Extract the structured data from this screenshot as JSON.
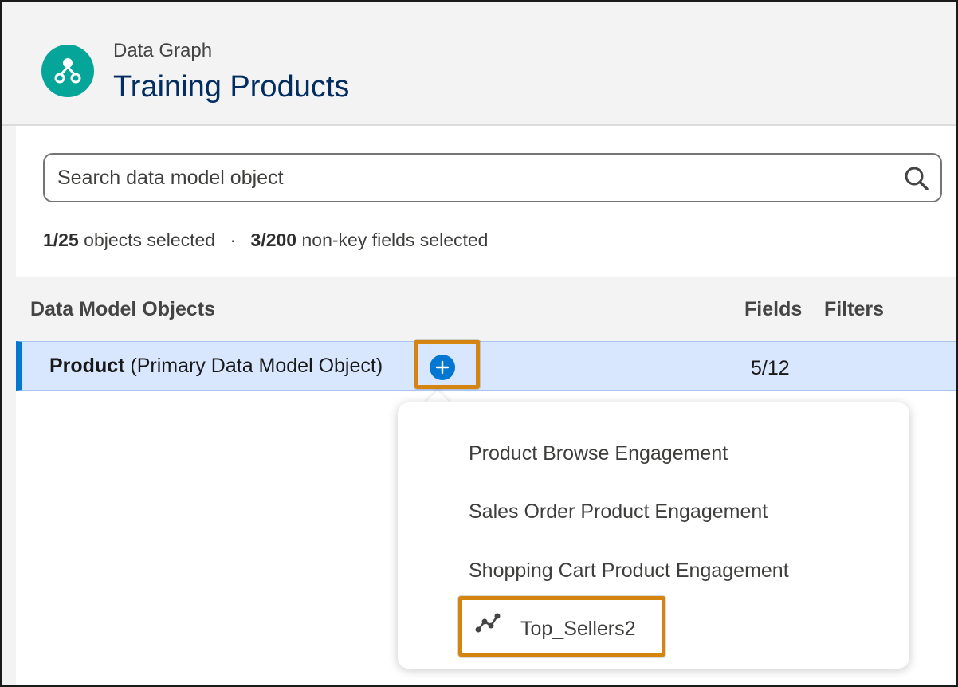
{
  "header": {
    "icon": "data-graph-icon",
    "eyebrow": "Data Graph",
    "title": "Training Products"
  },
  "search": {
    "placeholder": "Search data model object",
    "icon": "search-icon"
  },
  "counts": {
    "objects_count": "1/25",
    "objects_label": "objects selected",
    "separator": "·",
    "fields_count": "3/200",
    "fields_label": "non-key fields selected"
  },
  "table": {
    "columns": [
      "Data Model Objects",
      "Fields",
      "Filters"
    ],
    "rows": [
      {
        "name": "Product",
        "qualifier": "(Primary Data Model Object)",
        "fields": "5/12",
        "filters": ""
      }
    ]
  },
  "menu": {
    "items": [
      {
        "label": "Product Browse Engagement"
      },
      {
        "label": "Sales Order Product Engagement"
      },
      {
        "label": "Shopping Cart Product Engagement"
      },
      {
        "label": "Top_Sellers2",
        "icon": "graph-path-icon"
      }
    ]
  },
  "colors": {
    "brand_teal": "#06a59a",
    "title_navy": "#032d60",
    "accent_blue": "#0176d3",
    "selected_row": "#d8e6fe",
    "highlight_orange": "#d68410"
  }
}
